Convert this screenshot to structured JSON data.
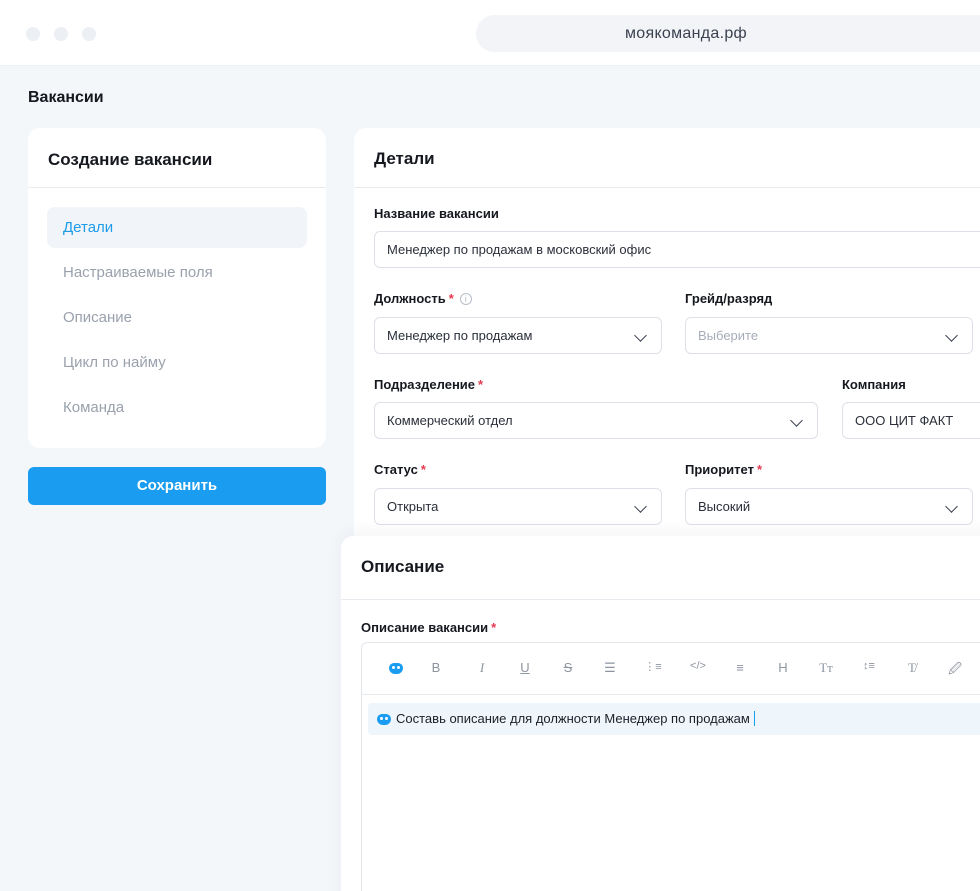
{
  "browser": {
    "url": "моякоманда.рф"
  },
  "page": {
    "title": "Вакансии"
  },
  "steps": {
    "title": "Создание вакансии",
    "items": [
      {
        "label": "Детали",
        "active": true
      },
      {
        "label": "Настраиваемые поля",
        "active": false
      },
      {
        "label": "Описание",
        "active": false
      },
      {
        "label": "Цикл по найму",
        "active": false
      },
      {
        "label": "Команда",
        "active": false
      }
    ],
    "save_label": "Сохранить"
  },
  "details": {
    "title": "Детали",
    "vacancy_name": {
      "label": "Название вакансии",
      "value": "Менеджер по продажам в московский офис"
    },
    "position": {
      "label": "Должность",
      "value": "Менеджер по продажам",
      "required": true
    },
    "grade": {
      "label": "Грейд/разряд",
      "placeholder": "Выберите"
    },
    "department": {
      "label": "Подразделение",
      "value": "Коммерческий отдел",
      "required": true
    },
    "company": {
      "label": "Компания",
      "value": "ООО ЦИТ ФАКТ"
    },
    "status": {
      "label": "Статус",
      "value": "Открыта",
      "required": true
    },
    "priority": {
      "label": "Приоритет",
      "value": "Высокий",
      "required": true
    }
  },
  "description": {
    "title": "Описание",
    "field_label": "Описание вакансии",
    "toolbar": [
      "B",
      "I",
      "U",
      "S",
      "☰",
      "⋮≡",
      "</>",
      "≡",
      "H",
      "Tт",
      "↕≡",
      "T̸",
      "🖉"
    ],
    "prompt": "Составь описание для должности Менеджер по продажам"
  },
  "colors": {
    "accent": "#1a9df0",
    "required": "#e53950",
    "background": "#f4f7fa"
  }
}
